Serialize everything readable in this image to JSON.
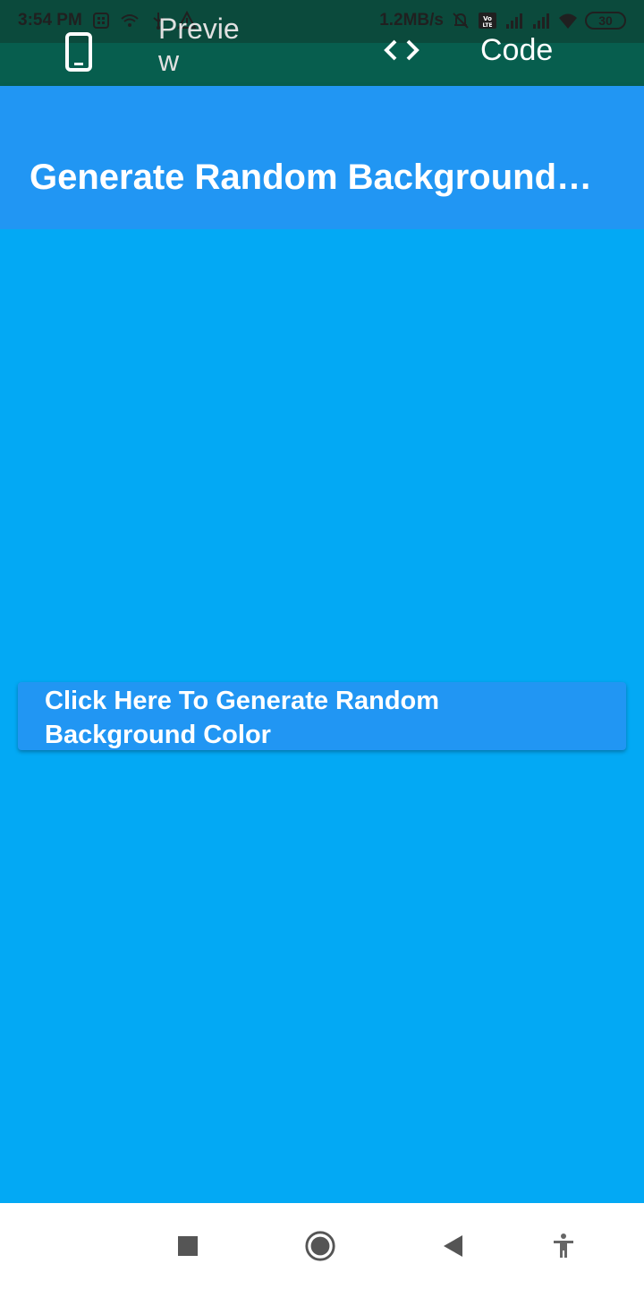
{
  "status_bar": {
    "time": "3:54 PM",
    "network_speed": "1.2MB/s",
    "battery_level": "30",
    "icons": [
      "sim-card-icon",
      "wifi-calling-icon",
      "usb-icon",
      "alert-icon",
      "mute-bell-icon",
      "volte-icon",
      "signal-icon",
      "signal-icon",
      "wifi-icon",
      "battery-icon"
    ]
  },
  "tabs": {
    "preview_label": "Preview",
    "code_label": "Code",
    "preview_icon": "phone-icon",
    "code_icon": "code-brackets-icon"
  },
  "appbar": {
    "title": "Generate Random Background Color"
  },
  "main": {
    "background_color": "#03A9F4",
    "button_label": "Click Here To Generate Random Background Color"
  },
  "nav": {
    "icons": [
      "recents-square-icon",
      "home-circle-icon",
      "back-triangle-icon",
      "accessibility-icon"
    ]
  },
  "colors": {
    "status_bar": "#0b4a3c",
    "tab_bar": "#075e4e",
    "appbar": "#2196F3",
    "button": "#2196F3"
  }
}
